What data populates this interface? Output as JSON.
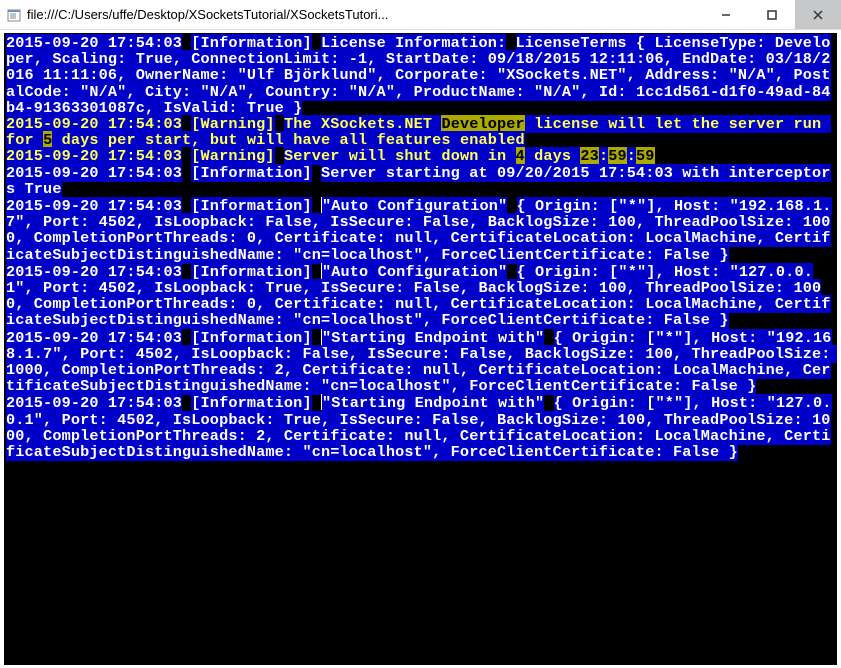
{
  "window": {
    "title": "file:///C:/Users/uffe/Desktop/XSocketsTutorial/XSocketsTutori..."
  },
  "lines": {
    "l1_ts": "2015-09-20 17:54:03",
    "l1_tag": "[Information]",
    "l1_head": "License Information:",
    "l1_body": "LicenseTerms { LicenseType: Developer, Scaling: True, ConnectionLimit: -1, StartDate: 09/18/2015 12:11:06, EndDate: 03/18/2016 11:11:06, OwnerName: \"Ulf Björklund\", Corporate: \"XSockets.NET\", Address: \"N/A\", PostalCode: \"N/A\", City: \"N/A\", Country: \"N/A\", ProductName: \"N/A\", Id: 1cc1d561-d1f0-49ad-84b4-91363301087c, IsValid: True }",
    "l2_ts": "2015-09-20 17:54:03",
    "l2_tag": "[Warning]",
    "l2_a": "The XSockets.NET ",
    "l2_dev": "Developer",
    "l2_b": " license will let the server run for ",
    "l2_days": "5",
    "l2_c": " days per start, but will have all features enabled",
    "l3_ts": "2015-09-20 17:54:03",
    "l3_tag": "[Warning]",
    "l3_a": "Server will shut down in ",
    "l3_d": "4",
    "l3_b": " days ",
    "l3_h": "23",
    "l3_m": "59",
    "l3_s": "59",
    "l4_ts": "2015-09-20 17:54:03",
    "l4_tag": "[Information]",
    "l4_a": "Server starting at ",
    "l4_time": "09/20/2015 17:54:03",
    "l4_b": " with interceptors ",
    "l4_true": "True",
    "l5_ts": "2015-09-20 17:54:03",
    "l5_tag": "[Information]",
    "l5_name": "\"Auto Configuration\"",
    "l5_body": "{ Origin: [\"*\"], Host: \"192.168.1.7\", Port: 4502, IsLoopback: False, IsSecure: False, BacklogSize: 100, ThreadPoolSize: 1000, CompletionPortThreads: 0, Certificate: null, CertificateLocation: LocalMachine, CertificateSubjectDistinguishedName: \"cn=localhost\", ForceClientCertificate: False }",
    "l6_ts": "2015-09-20 17:54:03",
    "l6_tag": "[Information]",
    "l6_name": "\"Auto Configuration\"",
    "l6_body": "{ Origin: [\"*\"], Host: \"127.0.0.1\", Port: 4502, IsLoopback: True, IsSecure: False, BacklogSize: 100, ThreadPoolSize: 1000, CompletionPortThreads: 0, Certificate: null, CertificateLocation: LocalMachine, CertificateSubjectDistinguishedName: \"cn=localhost\", ForceClientCertificate: False }",
    "l7_ts": "2015-09-20 17:54:03",
    "l7_tag": "[Information]",
    "l7_name": "\"Starting Endpoint with\"",
    "l7_body": "{ Origin: [\"*\"], Host: \"192.168.1.7\", Port: 4502, IsLoopback: False, IsSecure: False, BacklogSize: 100, ThreadPoolSize: 1000, CompletionPortThreads: 2, Certificate: null, CertificateLocation: LocalMachine, CertificateSubjectDistinguishedName: \"cn=localhost\", ForceClientCertificate: False }",
    "l8_ts": "2015-09-20 17:54:03",
    "l8_tag": "[Information]",
    "l8_name": "\"Starting Endpoint with\"",
    "l8_body": "{ Origin: [\"*\"], Host: \"127.0.0.1\", Port: 4502, IsLoopback: True, IsSecure: False, BacklogSize: 100, ThreadPoolSize: 1000, CompletionPortThreads: 2, Certificate: null, CertificateLocation: LocalMachine, CertificateSubjectDistinguishedName: \"cn=localhost\", ForceClientCertificate: False }"
  }
}
